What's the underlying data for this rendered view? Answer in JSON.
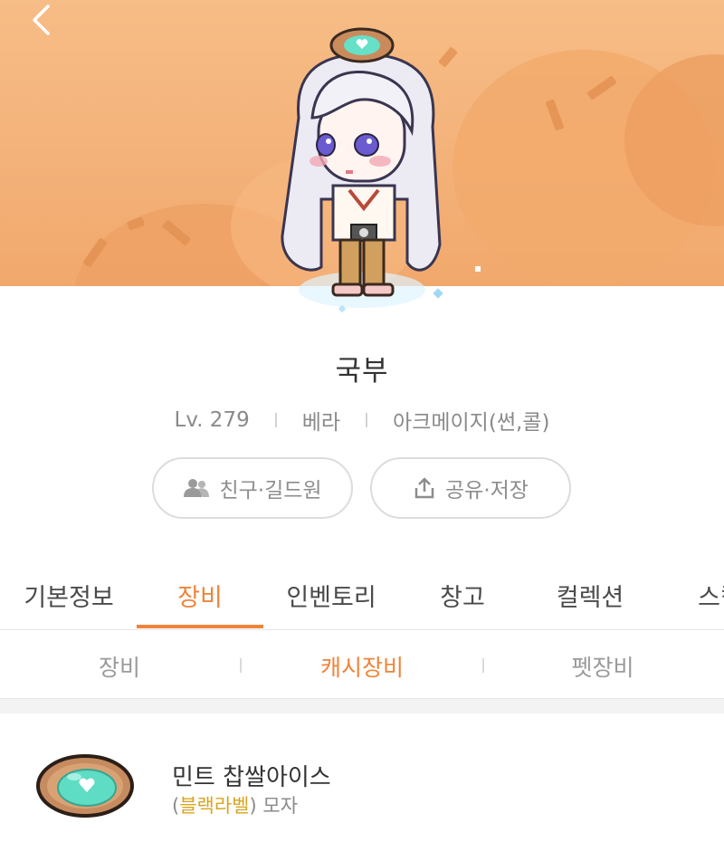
{
  "header": {
    "back_icon": "chevron-left-icon",
    "avatar_alt": "pixel character avatar"
  },
  "profile": {
    "name": "국부",
    "level": "Lv. 279",
    "world": "베라",
    "job": "아크메이지(썬,콜)"
  },
  "actions": {
    "friends_icon": "people-icon",
    "friends_label": "친구·길드원",
    "share_icon": "share-icon",
    "share_label": "공유·저장"
  },
  "tabs": [
    {
      "label": "기본정보",
      "active": false
    },
    {
      "label": "장비",
      "active": true
    },
    {
      "label": "인벤토리",
      "active": false
    },
    {
      "label": "창고",
      "active": false
    },
    {
      "label": "컬렉션",
      "active": false
    },
    {
      "label": "스킬",
      "active": false
    }
  ],
  "subtabs": [
    {
      "label": "장비",
      "active": false
    },
    {
      "label": "캐시장비",
      "active": true
    },
    {
      "label": "펫장비",
      "active": false
    }
  ],
  "items": [
    {
      "name": "민트 찹쌀아이스",
      "label_open": "(",
      "label": "블랙라벨",
      "label_close": ")",
      "category": "모자",
      "icon": "mint-rice-cake-ice-icon"
    }
  ],
  "colors": {
    "accent": "#f0843a",
    "hero_bg": "#f3b27a",
    "label_gold": "#d8a521"
  }
}
